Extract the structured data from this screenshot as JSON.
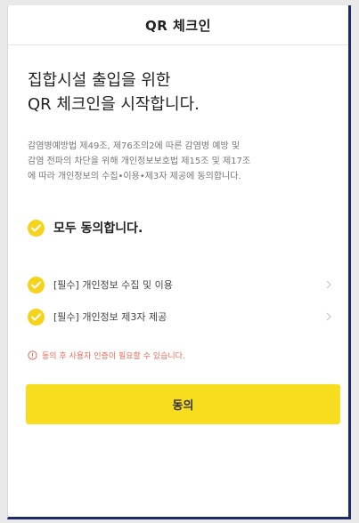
{
  "header": {
    "title": "QR 체크인"
  },
  "headline": {
    "line1": "집합시설 출입을 위한",
    "line2": "QR 체크인을 시작합니다."
  },
  "description": {
    "line1": "감염병예방법 제49조, 제76조의2에 따른 감염병 예방 및",
    "line2": "감염 전파의 차단을 위해 개인정보보호법 제15조 및 제17조",
    "line3": "에 따라 개인정보의 수집•이용•제3자 제공에 동의합니다."
  },
  "agree_all": {
    "label": "모두 동의합니다.",
    "checked": true
  },
  "items": [
    {
      "label": "[필수] 개인정보 수집 및 이용",
      "checked": true
    },
    {
      "label": "[필수] 개인정보 제3자 제공",
      "checked": true
    }
  ],
  "notice": {
    "text": "동의 후 사용자 인증이 필요할 수 있습니다."
  },
  "button": {
    "label": "동의"
  },
  "colors": {
    "accent": "#f8dd1e",
    "check": "#f5d31b",
    "notice": "#e36b5a"
  },
  "icons": {
    "check": "checkmark-circle-icon",
    "chevron": "chevron-right-icon",
    "notice": "info-circle-icon"
  }
}
